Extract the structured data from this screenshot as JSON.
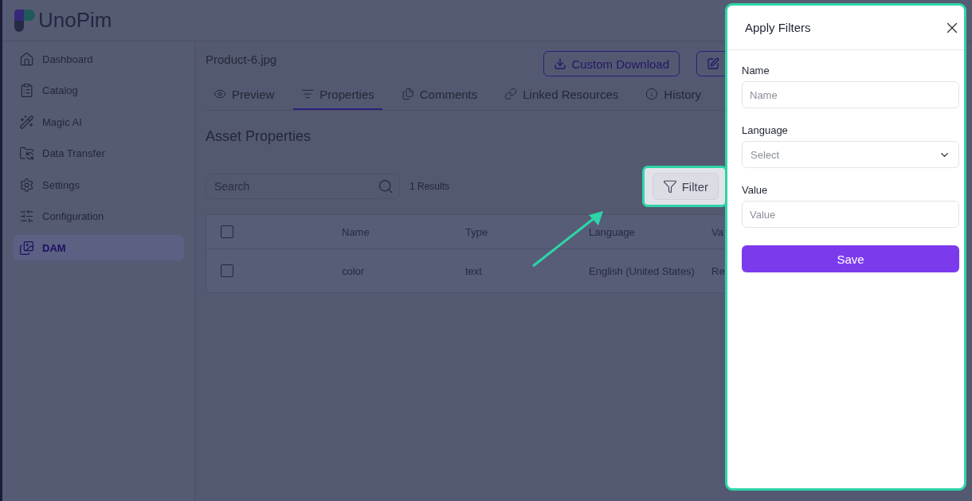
{
  "logo": {
    "text": "UnoPim"
  },
  "sidebar": {
    "items": [
      {
        "label": "Dashboard",
        "selected": false
      },
      {
        "label": "Catalog",
        "selected": false
      },
      {
        "label": "Magic AI",
        "selected": false
      },
      {
        "label": "Data Transfer",
        "selected": false
      },
      {
        "label": "Settings",
        "selected": false
      },
      {
        "label": "Configuration",
        "selected": false
      },
      {
        "label": "DAM",
        "selected": true
      }
    ]
  },
  "asset": {
    "title": "Product-6.jpg",
    "download_button": "Custom Download"
  },
  "tabs": [
    {
      "label": "Preview",
      "selected": false
    },
    {
      "label": "Properties",
      "selected": true
    },
    {
      "label": "Comments",
      "selected": false
    },
    {
      "label": "Linked Resources",
      "selected": false
    },
    {
      "label": "History",
      "selected": false
    }
  ],
  "section": {
    "title": "Asset Properties"
  },
  "search": {
    "placeholder": "Search"
  },
  "results": "1 Results",
  "filter_button": {
    "label": "Filter",
    "highlighted": true
  },
  "table": {
    "columns": [
      "Name",
      "Type",
      "Language",
      "Va"
    ],
    "header_checked": false,
    "rows": [
      {
        "checked": false,
        "cells": [
          "color",
          "text",
          "English (United States)",
          "Re"
        ]
      }
    ]
  },
  "drawer": {
    "title": "Apply Filters",
    "fields": [
      {
        "kind": "input",
        "label": "Name",
        "placeholder": "Name"
      },
      {
        "kind": "select",
        "label": "Language",
        "placeholder": "Select"
      },
      {
        "kind": "input",
        "label": "Value",
        "placeholder": "Value"
      }
    ],
    "submit": "Save"
  }
}
